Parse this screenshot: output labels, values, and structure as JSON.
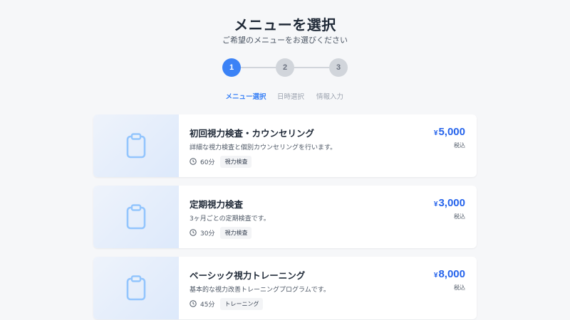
{
  "header": {
    "title": "メニューを選択",
    "subtitle": "ご希望のメニューをお選びください"
  },
  "stepper": {
    "steps": [
      {
        "number": "1",
        "label": "メニュー選択",
        "active": true
      },
      {
        "number": "2",
        "label": "日時選択",
        "active": false
      },
      {
        "number": "3",
        "label": "情報入力",
        "active": false
      }
    ]
  },
  "colors": {
    "accent": "#3b82f6",
    "price": "#2563eb",
    "thumb_icon": "#93c5fd"
  },
  "menus": [
    {
      "title": "初回視力検査・カウンセリング",
      "description": "詳細な視力検査と個別カウンセリングを行います。",
      "duration": "60分",
      "tag": "視力検査",
      "currency": "¥",
      "price": "5,000",
      "tax_note": "税込",
      "icon": "clipboard-icon"
    },
    {
      "title": "定期視力検査",
      "description": "3ヶ月ごとの定期検査です。",
      "duration": "30分",
      "tag": "視力検査",
      "currency": "¥",
      "price": "3,000",
      "tax_note": "税込",
      "icon": "clipboard-icon"
    },
    {
      "title": "ベーシック視力トレーニング",
      "description": "基本的な視力改善トレーニングプログラムです。",
      "duration": "45分",
      "tag": "トレーニング",
      "currency": "¥",
      "price": "8,000",
      "tax_note": "税込",
      "icon": "clipboard-icon"
    }
  ]
}
